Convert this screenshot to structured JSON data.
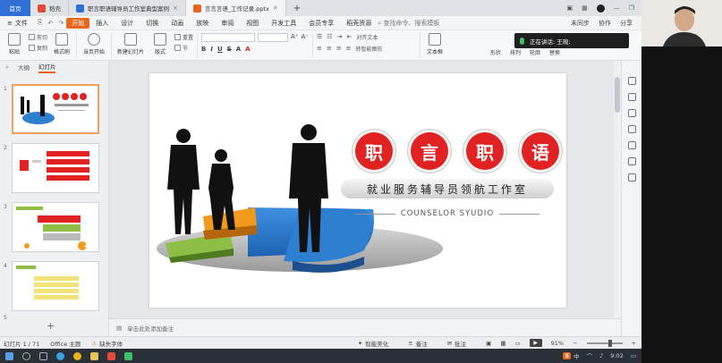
{
  "tabs": {
    "home": "首页",
    "items": [
      {
        "label": "稻壳",
        "icon": "docer-icon"
      },
      {
        "label": "职言职语辅导员工作室典型案例",
        "icon": "doc-icon"
      },
      {
        "label": "言言言语_工作记录.pptx",
        "icon": "ppt-icon"
      }
    ]
  },
  "menu": {
    "file": "文件",
    "items": [
      "开始",
      "插入",
      "设计",
      "切换",
      "动画",
      "放映",
      "审阅",
      "视图",
      "开发工具",
      "会员专享",
      "稻壳资源"
    ],
    "active": "开始",
    "search": "查找命令、搜索模板",
    "right": [
      "未同步",
      "协作",
      "分享"
    ]
  },
  "ribbon": {
    "paste": "粘贴",
    "cut": "剪切",
    "copy": "复制",
    "format_painter": "格式刷",
    "from_current": "当页开始",
    "new_slide": "新建幻灯片",
    "layout": "版式",
    "section": "节",
    "reset": "重置",
    "text_box": "文本框",
    "shape": "形状",
    "arrange": "排列",
    "outline": "轮廓",
    "replace": "替换",
    "convert_to_smartart": "转智能图形",
    "text_direction": "对齐文本"
  },
  "meeting": {
    "speaking_label": "正在讲话: 王琬;"
  },
  "left_panel": {
    "tab_outline": "大纲",
    "tab_slides": "幻灯片",
    "slide_numbers": [
      "1",
      "2",
      "3",
      "4",
      "5"
    ],
    "add": "+"
  },
  "slide": {
    "title_chars": [
      "职",
      "言",
      "职",
      "语"
    ],
    "subtitle": "就业服务辅导员领航工作室",
    "english": "COUNSELOR SYUDIO"
  },
  "notes": {
    "placeholder": "单击此处添加备注"
  },
  "status": {
    "slide_pos": "幻灯片 1 / 71",
    "theme": "Office 主题",
    "missing_font": "缺失字体",
    "smart_beautify": "智能美化",
    "notes": "备注",
    "comments": "批注",
    "zoom": "91%"
  },
  "taskbar": {
    "time": "9:02",
    "ime": "中"
  },
  "colors": {
    "accent": "#e8661c",
    "home_tab": "#2f6fd6",
    "title_circle": "#e02222",
    "pie_blue": "#2f7fd0",
    "pie_orange": "#f29a1e",
    "pie_green": "#8fbe46"
  }
}
